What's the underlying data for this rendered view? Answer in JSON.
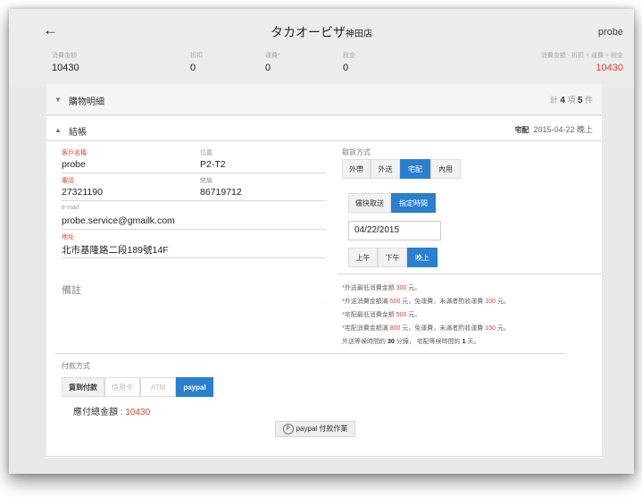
{
  "header": {
    "back_icon": "arrow-left-icon",
    "title": "タカオービザ",
    "branch": "神田店",
    "user": "probe"
  },
  "stats": [
    {
      "label": "消費金額",
      "value": "10430"
    },
    {
      "label": "折扣",
      "value": "0"
    },
    {
      "label": "運費*",
      "value": "0"
    },
    {
      "label": "稅金",
      "value": "0"
    },
    {
      "label": "消費金額 - 折扣 + 運費 + 稅金",
      "value": "10430"
    }
  ],
  "cart_bar": {
    "title": "購物明細",
    "count_prefix": "計",
    "items": "4",
    "items_unit": "項",
    "qty": "5",
    "qty_unit": "件"
  },
  "checkout": {
    "title": "結帳",
    "mode": "宅配",
    "datetime": "2015-04-22 晚上"
  },
  "customer": {
    "name_label": "客戶名稱",
    "name": "probe",
    "position_label": "位置",
    "position": "P2-T2",
    "phone_label": "電話",
    "phone": "27321190",
    "ext_label": "統編",
    "ext": "86719712",
    "email_label": "e-mail",
    "email": "probe.service@gmailk.com",
    "address_label": "地址",
    "address": "北市基隆路二段189號14F",
    "notes_label": "備註"
  },
  "pickup": {
    "label": "取貨方式",
    "options": [
      "外帶",
      "外送",
      "宅配",
      "內用"
    ],
    "selected": 2,
    "timing_options": [
      "儘快取送",
      "指定時間"
    ],
    "timing_selected": 1,
    "date": "04/22/2015",
    "periods": [
      "上午",
      "下午",
      "晚上"
    ],
    "period_selected": 2
  },
  "notes": [
    {
      "pre": "*外送最低消費金額 ",
      "num": "300",
      "post": " 元。",
      "post_num": "",
      "tail": ""
    },
    {
      "pre": "*外送消費金額滿 ",
      "num": "500",
      "post": " 元，免運費，未滿者酌收運費 ",
      "post_num": "100",
      "tail": " 元。"
    },
    {
      "pre": "*宅配最低消費金額 ",
      "num": "500",
      "post": " 元。",
      "post_num": "",
      "tail": ""
    },
    {
      "pre": "*宅配消費金額滿 ",
      "num": "800",
      "post": " 元，免運費，未滿者酌收運費 ",
      "post_num": "150",
      "tail": " 元。"
    }
  ],
  "wait_note": {
    "pre": "外送等候時間約 ",
    "a": "30",
    "mid": " 分鐘， 宅配等候時間約 ",
    "b": "1",
    "post": " 天。"
  },
  "payment": {
    "label": "付款方式",
    "options": [
      "貨到付款",
      "信用卡",
      "ATM",
      "paypal"
    ],
    "selected": 3,
    "total_label": "應付總金額 : ",
    "total": "10430",
    "paypal_button": "paypal 付款作業",
    "paypal_icon": "paypal-icon"
  },
  "colors": {
    "accent": "#2a7fcf",
    "highlight": "#e0412c"
  }
}
